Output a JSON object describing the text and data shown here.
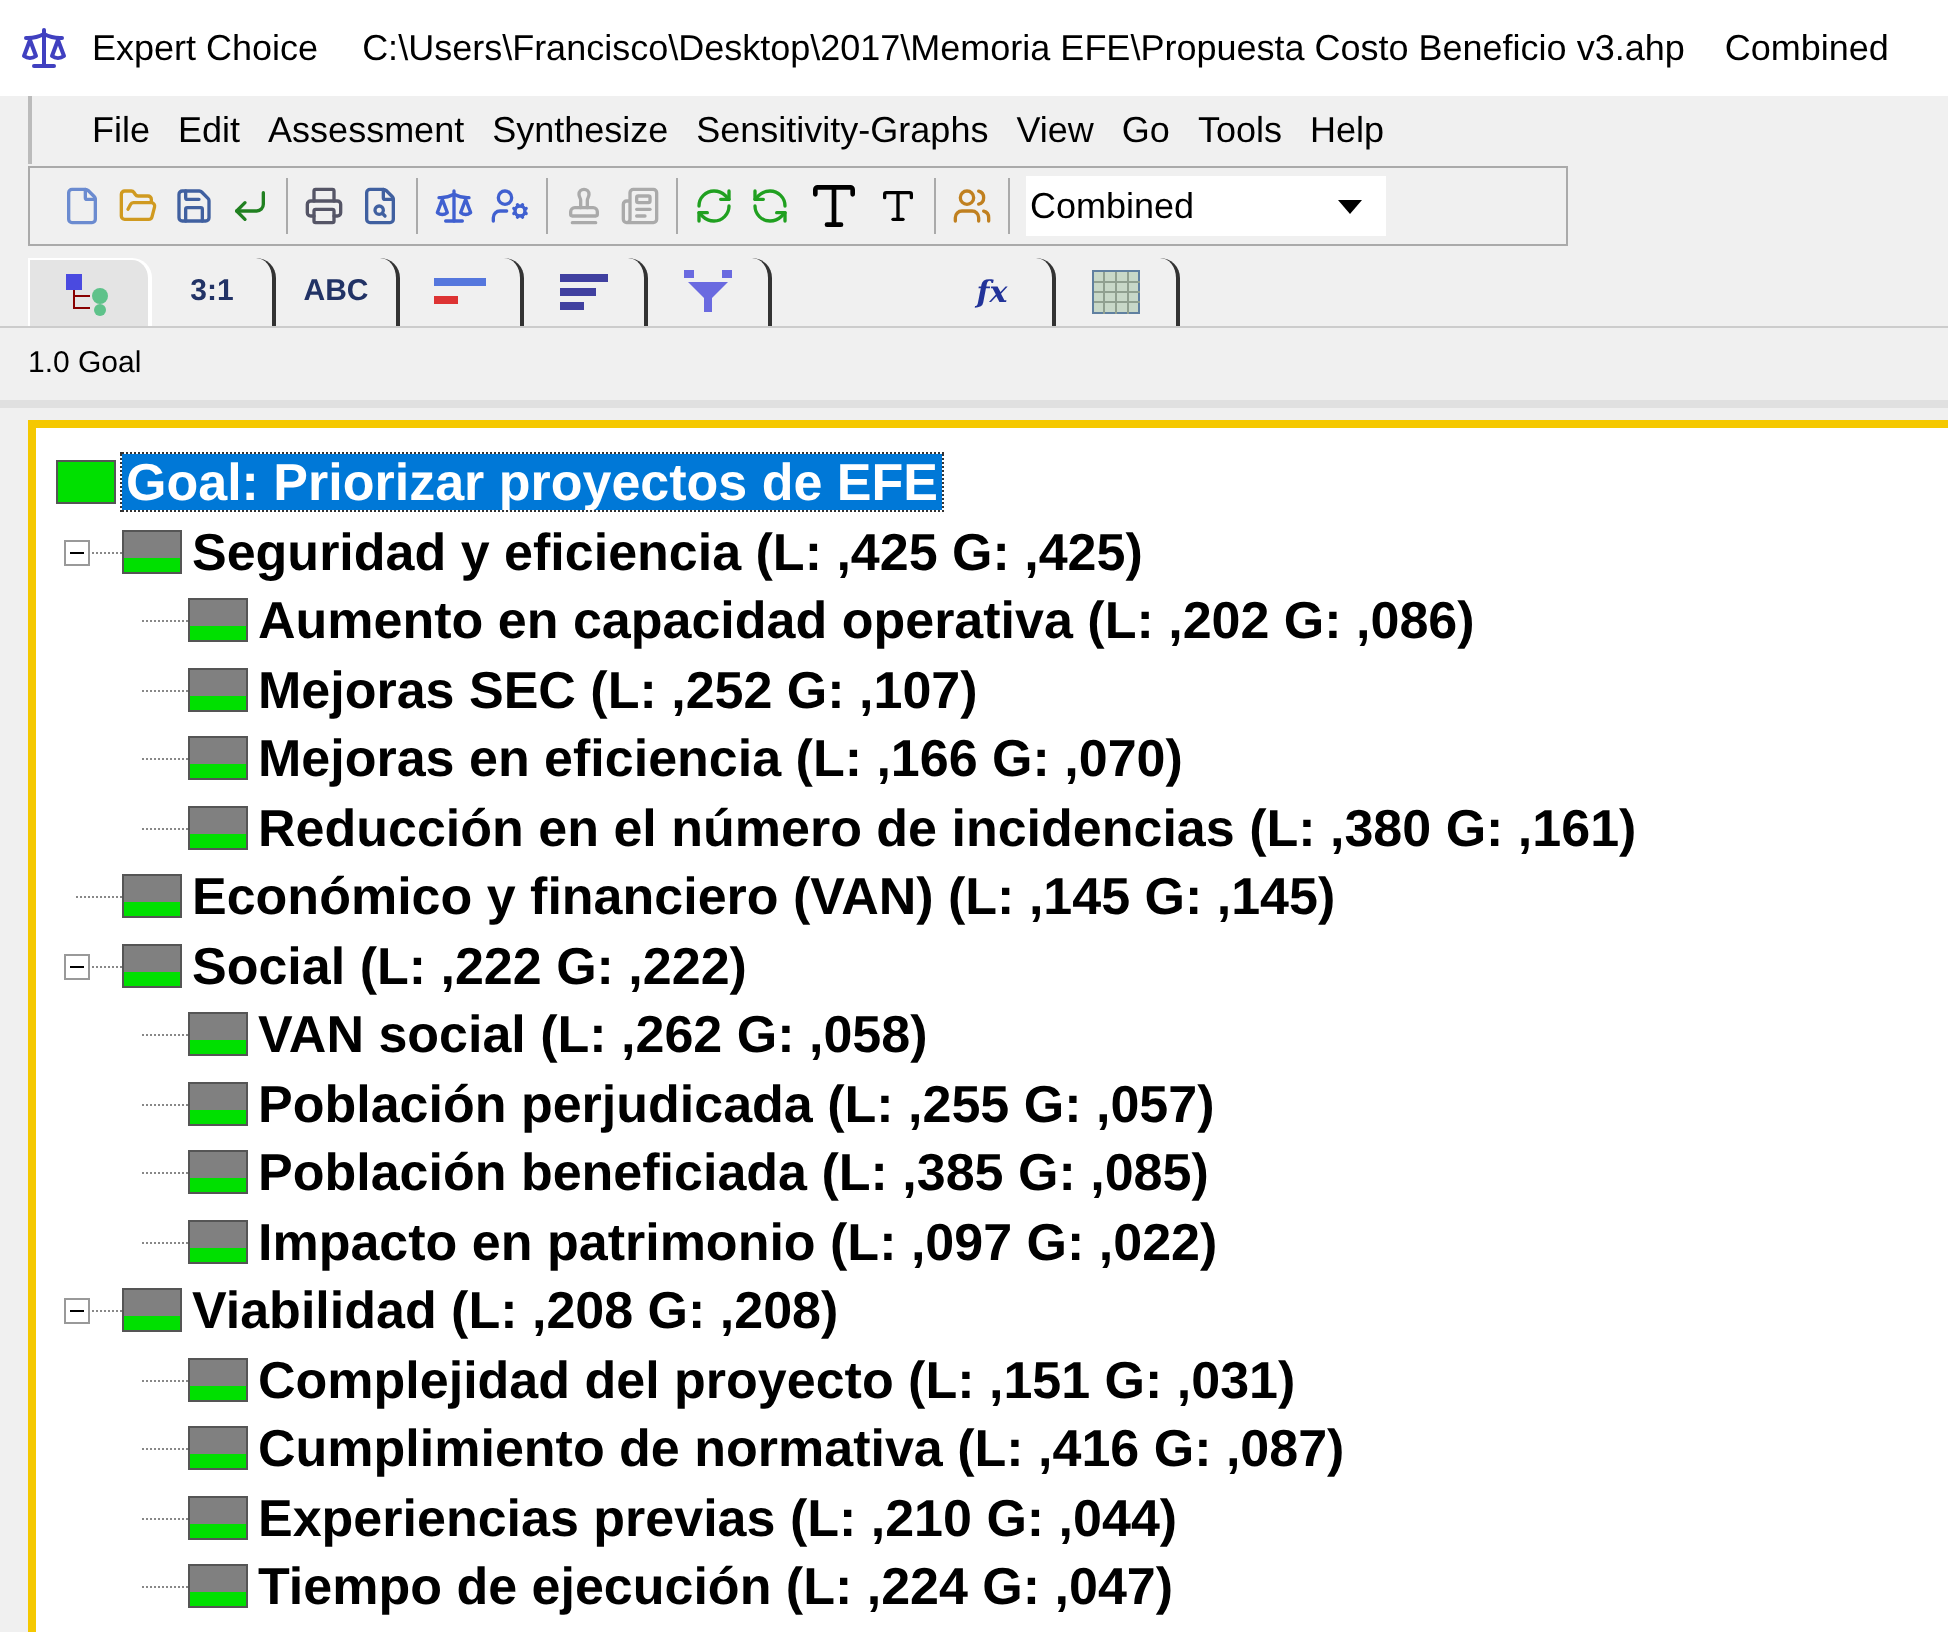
{
  "window": {
    "title": "Expert Choice",
    "path": "C:\\Users\\Francisco\\Desktop\\2017\\Memoria EFE\\Propuesta Costo Beneficio v3.ahp",
    "mode": "Combined"
  },
  "menu": [
    "File",
    "Edit",
    "Assessment",
    "Synthesize",
    "Sensitivity-Graphs",
    "View",
    "Go",
    "Tools",
    "Help"
  ],
  "toolbar": {
    "combo_value": "Combined"
  },
  "tabs": [
    {
      "kind": "tree",
      "selected": true
    },
    {
      "kind": "text",
      "label": "3:1",
      "selected": false
    },
    {
      "kind": "text",
      "label": "ABC",
      "selected": false
    },
    {
      "kind": "bars2",
      "selected": false
    },
    {
      "kind": "bars3",
      "selected": false
    },
    {
      "kind": "funnel",
      "selected": false
    },
    {
      "kind": "gap"
    },
    {
      "kind": "formula",
      "label": "fx",
      "selected": false
    },
    {
      "kind": "grid",
      "selected": false
    }
  ],
  "breadcrumb": "1.0 Goal",
  "tree": {
    "label": "Goal: Priorizar proyectos de EFE",
    "selected": true,
    "children": [
      {
        "label": "Seguridad y eficiencia (L: ,425 G: ,425)",
        "expanded": true,
        "children": [
          {
            "label": "Aumento en capacidad operativa (L: ,202 G: ,086)"
          },
          {
            "label": "Mejoras SEC (L: ,252 G: ,107)"
          },
          {
            "label": "Mejoras en eficiencia (L: ,166 G: ,070)"
          },
          {
            "label": "Reducción en el número de incidencias (L: ,380 G: ,161)"
          }
        ]
      },
      {
        "label": "Económico y financiero (VAN) (L: ,145 G: ,145)"
      },
      {
        "label": "Social (L: ,222 G: ,222)",
        "expanded": true,
        "children": [
          {
            "label": "VAN social (L: ,262 G: ,058)"
          },
          {
            "label": "Población perjudicada (L: ,255 G: ,057)"
          },
          {
            "label": "Población beneficiada (L: ,385 G: ,085)"
          },
          {
            "label": "Impacto en patrimonio (L: ,097 G: ,022)"
          }
        ]
      },
      {
        "label": "Viabilidad (L: ,208 G: ,208)",
        "expanded": true,
        "children": [
          {
            "label": "Complejidad del proyecto (L: ,151 G: ,031)"
          },
          {
            "label": "Cumplimiento de normativa (L: ,416 G: ,087)"
          },
          {
            "label": "Experiencias previas (L: ,210 G: ,044)"
          },
          {
            "label": "Tiempo de ejecución (L: ,224 G: ,047)"
          }
        ]
      }
    ]
  }
}
